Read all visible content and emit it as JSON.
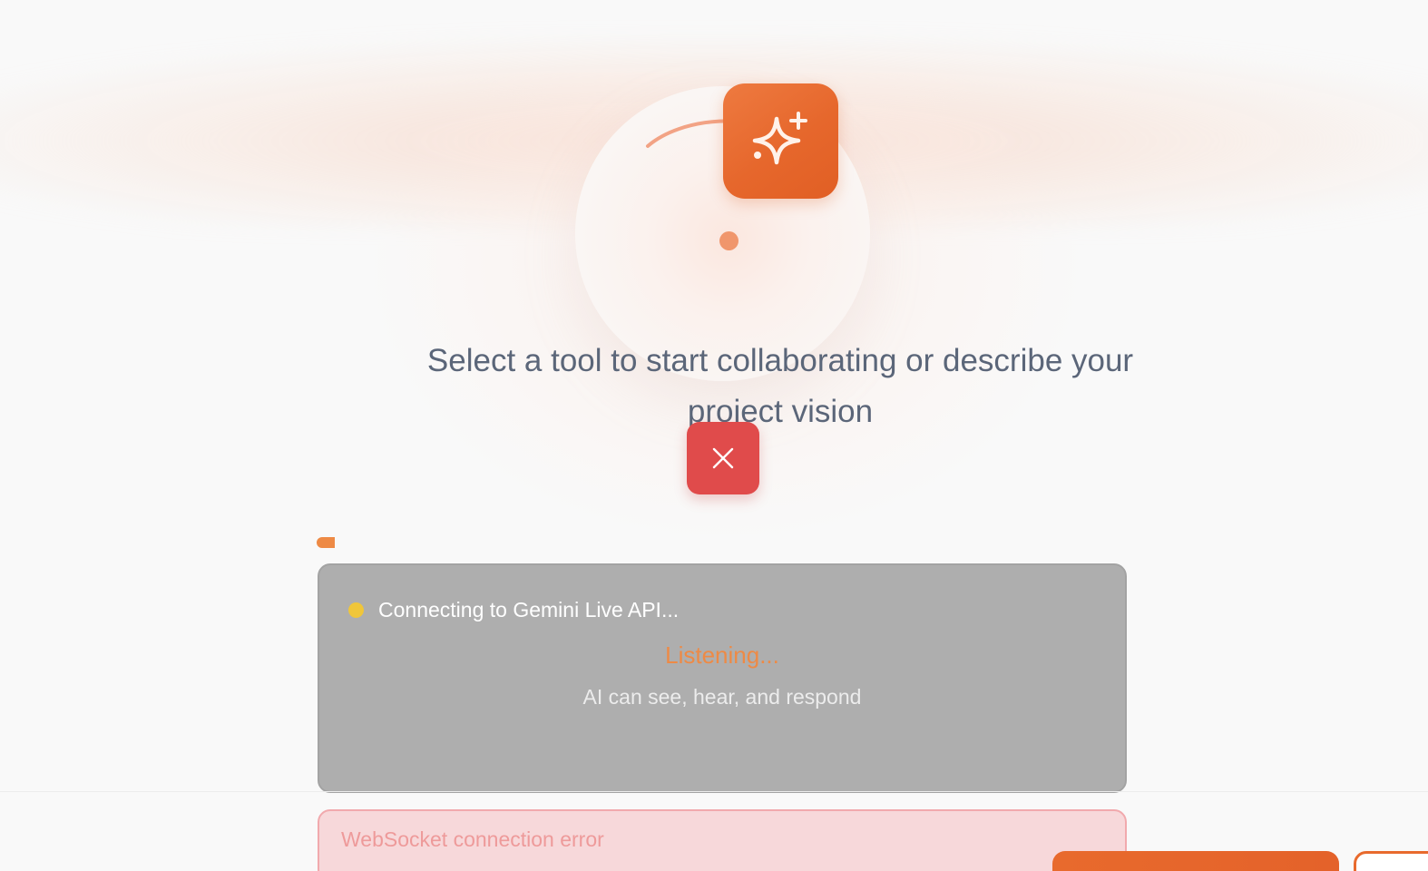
{
  "app": {
    "headline": "Select a tool to start collaborating or describe your project vision"
  },
  "ai_badge": {
    "icon": "sparkles-icon",
    "color": "#e6672c"
  },
  "close_button": {
    "icon": "close-icon",
    "color": "#e04b4b"
  },
  "status_panel": {
    "connection_status": "Connecting to Gemini Live API...",
    "connection_indicator_color": "#f0c63a",
    "listening_label": "Listening...",
    "listening_color": "#ee8a45",
    "capabilities": "AI can see, hear, and respond"
  },
  "error": {
    "message": "WebSocket connection error",
    "color": "#ee9a9a"
  },
  "colors": {
    "accent": "#e86a2d",
    "background": "#f9f9f9",
    "panel": "#aeaeae"
  }
}
